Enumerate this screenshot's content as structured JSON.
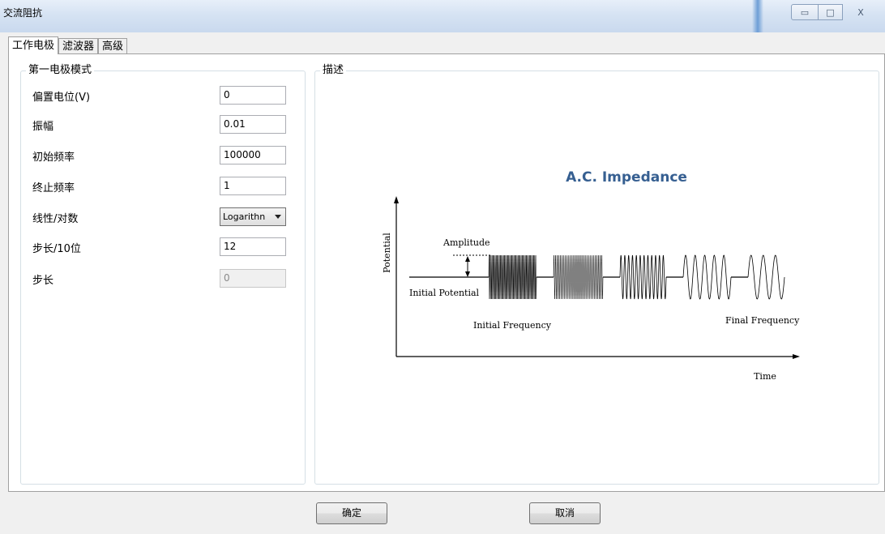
{
  "window": {
    "title": "交流阻抗",
    "minimize_symbol": "▭",
    "maximize_symbol": "□",
    "close_symbol": "X"
  },
  "tabs": [
    {
      "label": "工作电极",
      "active": true
    },
    {
      "label": "滤波器",
      "active": false
    },
    {
      "label": "高级",
      "active": false
    }
  ],
  "electrode_group": {
    "title": "第一电极模式",
    "fields": {
      "bias_potential": {
        "label": "偏置电位(V)",
        "value": "0"
      },
      "amplitude": {
        "label": "振幅",
        "value": "0.01"
      },
      "initial_frequency": {
        "label": "初始频率",
        "value": "100000"
      },
      "final_frequency": {
        "label": "终止频率",
        "value": "1"
      },
      "scale": {
        "label": "线性/对数",
        "value": "Logarithn"
      },
      "steps_per_decade": {
        "label": "步长/10位",
        "value": "12"
      },
      "step": {
        "label": "步长",
        "value": "0"
      }
    }
  },
  "description_group": {
    "title": "描述"
  },
  "diagram": {
    "title": "A.C. Impedance",
    "y_axis_label": "Potential",
    "x_axis_label": "Time",
    "amplitude_label": "Amplitude",
    "initial_potential_label": "Initial Potential",
    "initial_frequency_label": "Initial Frequency",
    "final_frequency_label": "Final Frequency",
    "title_color": "#365f91"
  },
  "buttons": {
    "ok": "确定",
    "cancel": "取消"
  }
}
